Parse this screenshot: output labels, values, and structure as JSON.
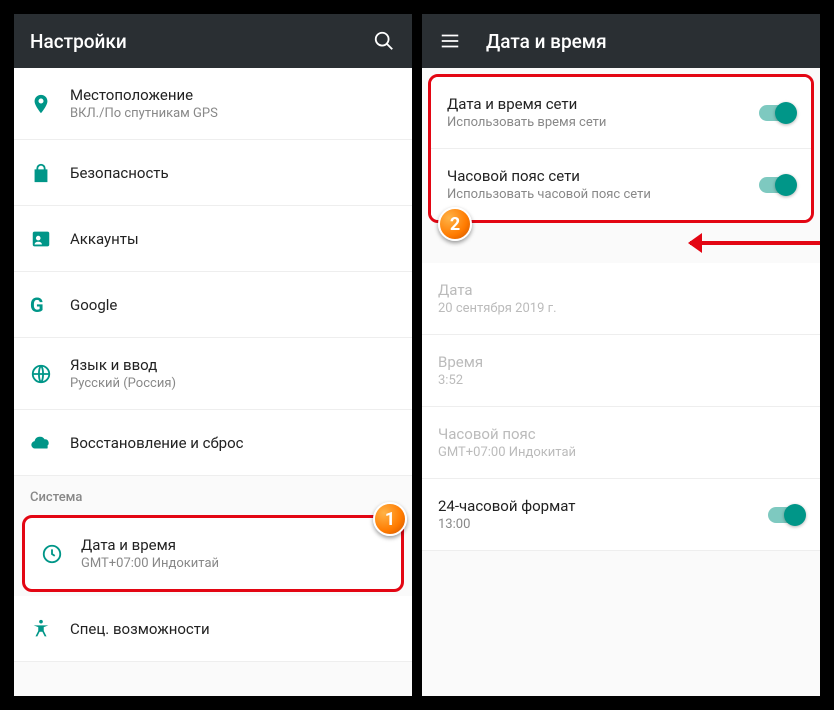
{
  "left": {
    "header": {
      "title": "Настройки"
    },
    "items": {
      "location": {
        "title": "Местоположение",
        "subtitle": "ВКЛ./По спутникам GPS"
      },
      "security": {
        "title": "Безопасность"
      },
      "accounts": {
        "title": "Аккаунты"
      },
      "google": {
        "title": "Google"
      },
      "language": {
        "title": "Язык и ввод",
        "subtitle": "Русский (Россия)"
      },
      "backup": {
        "title": "Восстановление и сброс"
      },
      "system_header": "Система",
      "datetime": {
        "title": "Дата и время",
        "subtitle": "GMT+07:00 Индокитай"
      },
      "accessibility": {
        "title": "Спец. возможности"
      }
    }
  },
  "right": {
    "header": {
      "title": "Дата и время"
    },
    "items": {
      "auto_time": {
        "title": "Дата и время сети",
        "subtitle": "Использовать время сети"
      },
      "auto_tz": {
        "title": "Часовой пояс сети",
        "subtitle": "Использовать часовой пояс сети"
      },
      "date": {
        "title": "Дата",
        "subtitle": "20 сентября 2019 г."
      },
      "time": {
        "title": "Время",
        "subtitle": "3:52"
      },
      "timezone": {
        "title": "Часовой пояс",
        "subtitle": "GMT+07:00 Индокитай"
      },
      "format24": {
        "title": "24-часовой формат",
        "subtitle": "13:00"
      }
    }
  },
  "badges": {
    "one": "1",
    "two": "2"
  }
}
